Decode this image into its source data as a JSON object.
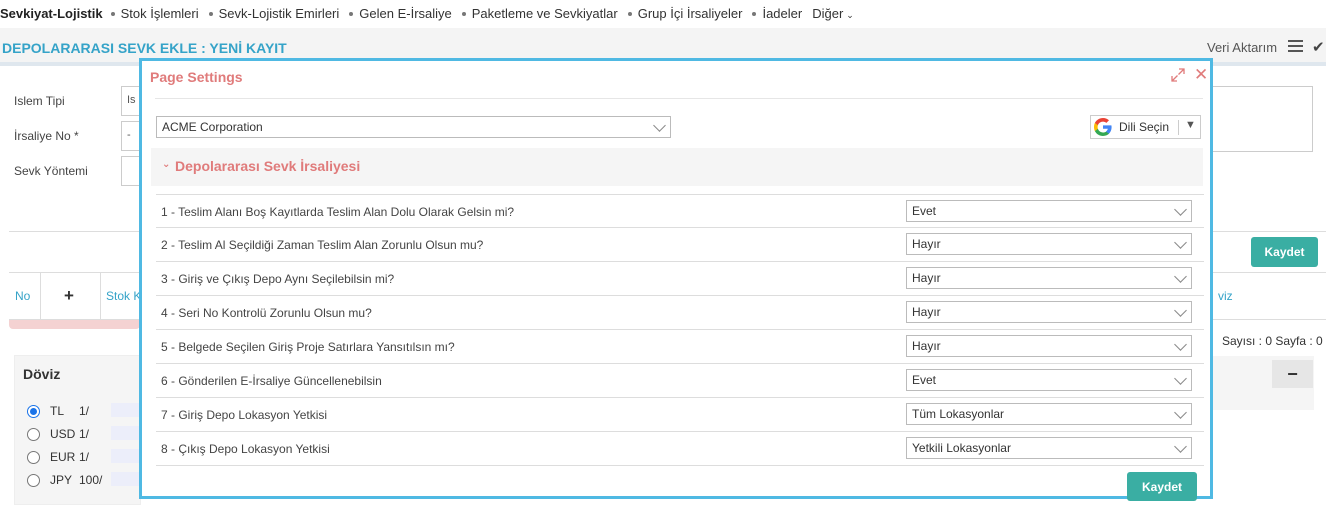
{
  "nav": {
    "brand": "Sevkiyat-Lojistik",
    "items": [
      "Stok İşlemleri",
      "Sevk-Lojistik Emirleri",
      "Gelen E-İrsaliye",
      "Paketleme ve Sevkiyatlar",
      "Grup İçi İrsaliyeler",
      "İadeler"
    ],
    "more": "Diğer"
  },
  "page": {
    "title": "DEPOLARARASI SEVK EKLE : YENİ KAYIT",
    "veri_aktarim": "Veri Aktarım"
  },
  "form": {
    "islem_tipi_label": "Islem Tipi",
    "islem_tipi_value": "Is",
    "irsaliye_no_label": "İrsaliye No *",
    "irsaliye_no_value": "-",
    "sevk_yontemi_label": "Sevk Yöntemi",
    "save_label": "Kaydet"
  },
  "grid": {
    "col_no": "No",
    "col_add": "+",
    "col_stok": "Stok K",
    "col_doviz": "viz",
    "footer": "Sayısı : 0 Sayfa : 0"
  },
  "doviz": {
    "title": "Döviz",
    "rows": [
      {
        "code": "TL",
        "rate": "1/",
        "selected": true
      },
      {
        "code": "USD",
        "rate": "1/",
        "selected": false
      },
      {
        "code": "EUR",
        "rate": "1/",
        "selected": false
      },
      {
        "code": "JPY",
        "rate": "100/",
        "selected": false
      }
    ],
    "collapse": "−"
  },
  "modal": {
    "title": "Page Settings",
    "company": "ACME Corporation",
    "language_label": "Dili Seçin",
    "section_title": "Depolararası Sevk İrsaliyesi",
    "settings": [
      {
        "label": "1 - Teslim Alanı Boş Kayıtlarda Teslim Alan Dolu Olarak Gelsin mi?",
        "value": "Evet"
      },
      {
        "label": "2 - Teslim Al Seçildiği Zaman Teslim Alan Zorunlu Olsun mu?",
        "value": "Hayır"
      },
      {
        "label": "3 - Giriş ve Çıkış Depo Aynı Seçilebilsin mi?",
        "value": "Hayır"
      },
      {
        "label": "4 - Seri No Kontrolü Zorunlu Olsun mu?",
        "value": "Hayır"
      },
      {
        "label": "5 - Belgede Seçilen Giriş Proje Satırlara Yansıtılsın mı?",
        "value": "Hayır"
      },
      {
        "label": "6 - Gönderilen E-İrsaliye Güncellenebilsin",
        "value": "Evet"
      },
      {
        "label": "7 - Giriş Depo Lokasyon Yetkisi",
        "value": "Tüm Lokasyonlar"
      },
      {
        "label": "8 - Çıkış Depo Lokasyon Yetkisi",
        "value": "Yetkili Lokasyonlar"
      }
    ],
    "save_label": "Kaydet"
  },
  "colors": {
    "accent_teal": "#3aaea3",
    "title_blue": "#35a3c8",
    "modal_border": "#4fb9e3",
    "modal_red": "#e07b7b"
  }
}
